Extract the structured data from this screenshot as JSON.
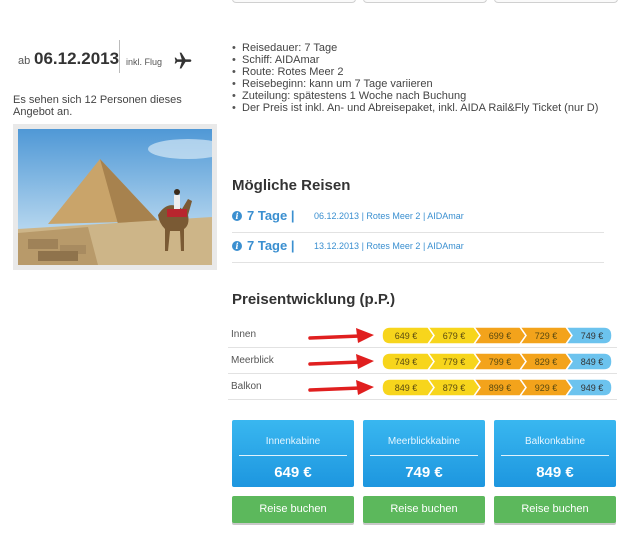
{
  "date_block": {
    "prefix": "ab",
    "date": "06.12.2013",
    "incl": "inkl. Flug",
    "icon": "plane-icon"
  },
  "viewers_text": "Es sehen sich 12 Personen dieses Angebot an.",
  "facts": [
    "Reisedauer: 7 Tage",
    "Schiff: AIDAmar",
    "Route: Rotes Meer 2",
    "Reisebeginn: kann um 7 Tage variieren",
    "Zuteilung: spätestens 1 Woche nach Buchung",
    "Der Preis ist inkl. An- und Abreisepaket, inkl. AIDA Rail&Fly Ticket (nur D)"
  ],
  "possible_trips": {
    "heading": "Mögliche Reisen",
    "items": [
      {
        "title": "7 Tage |",
        "date": "06.12.2013",
        "route": "| Rotes Meer 2",
        "ship": "|  AIDAmar"
      },
      {
        "title": "7 Tage |",
        "date": "13.12.2013",
        "route": "| Rotes Meer 2",
        "ship": "|  AIDAmar"
      }
    ]
  },
  "price_development": {
    "heading": "Preisentwicklung (p.P.)",
    "rows": [
      {
        "label": "Innen",
        "prices": [
          "649 €",
          "679 €",
          "699 €",
          "729 €",
          "749 €"
        ]
      },
      {
        "label": "Meerblick",
        "prices": [
          "749 €",
          "779 €",
          "799 €",
          "829 €",
          "849 €"
        ]
      },
      {
        "label": "Balkon",
        "prices": [
          "849 €",
          "879 €",
          "899 €",
          "929 €",
          "949 €"
        ]
      }
    ]
  },
  "cabins": [
    {
      "name": "Innenkabine",
      "price": "649 €",
      "button": "Reise buchen"
    },
    {
      "name": "Meerblickkabine",
      "price": "749 €",
      "button": "Reise buchen"
    },
    {
      "name": "Balkonkabine",
      "price": "849 €",
      "button": "Reise buchen"
    }
  ],
  "colors": {
    "link_blue": "#3a8fd0",
    "step_yellow": "#f7d51c",
    "step_orange": "#f3a31b",
    "step_blue": "#6cc3ee",
    "card_blue": "#29a8ea",
    "book_green": "#5cb85c",
    "arrow_red": "#e01f1f"
  }
}
